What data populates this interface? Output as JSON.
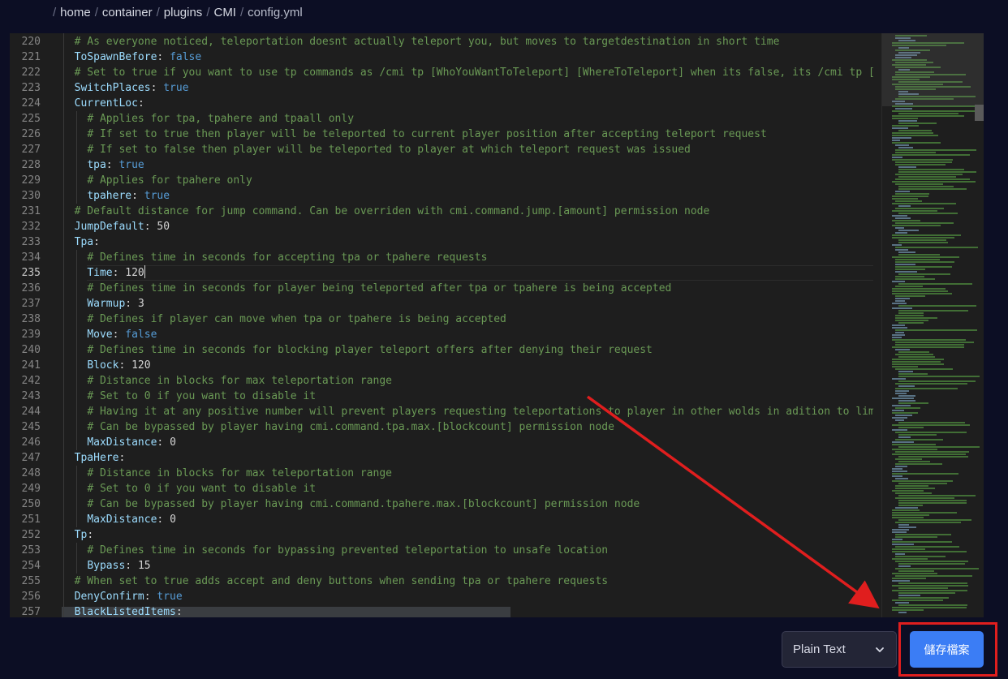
{
  "breadcrumb": {
    "separator": "/",
    "segments": [
      "home",
      "container",
      "plugins",
      "CMI",
      "config.yml"
    ]
  },
  "editor": {
    "active_line": 235,
    "lines": [
      {
        "num": "220",
        "indent": 1,
        "tokens": [
          {
            "t": "# As everyone noticed, teleportation doesnt actually teleport you, but moves to targetdestination in short time",
            "c": "comment"
          }
        ]
      },
      {
        "num": "221",
        "indent": 1,
        "tokens": [
          {
            "t": "ToSpawnBefore",
            "c": "key"
          },
          {
            "t": ": ",
            "c": "plain"
          },
          {
            "t": "false",
            "c": "bool"
          }
        ]
      },
      {
        "num": "222",
        "indent": 1,
        "tokens": [
          {
            "t": "# Set to true if you want to use tp commands as /cmi tp [WhoYouWantToTeleport] [WhereToTeleport] when its false, its /cmi tp [",
            "c": "comment"
          }
        ]
      },
      {
        "num": "223",
        "indent": 1,
        "tokens": [
          {
            "t": "SwitchPlaces",
            "c": "key"
          },
          {
            "t": ": ",
            "c": "plain"
          },
          {
            "t": "true",
            "c": "bool"
          }
        ]
      },
      {
        "num": "224",
        "indent": 1,
        "tokens": [
          {
            "t": "CurrentLoc",
            "c": "key"
          },
          {
            "t": ":",
            "c": "plain"
          }
        ]
      },
      {
        "num": "225",
        "indent": 2,
        "tokens": [
          {
            "t": "# Applies for tpa, tpahere and tpaall only",
            "c": "comment"
          }
        ]
      },
      {
        "num": "226",
        "indent": 2,
        "tokens": [
          {
            "t": "# If set to true then player will be teleported to current player position after accepting teleport request",
            "c": "comment"
          }
        ]
      },
      {
        "num": "227",
        "indent": 2,
        "tokens": [
          {
            "t": "# If set to false then player will be teleported to player at which teleport request was issued",
            "c": "comment"
          }
        ]
      },
      {
        "num": "228",
        "indent": 2,
        "tokens": [
          {
            "t": "tpa",
            "c": "key"
          },
          {
            "t": ": ",
            "c": "plain"
          },
          {
            "t": "true",
            "c": "bool"
          }
        ]
      },
      {
        "num": "229",
        "indent": 2,
        "tokens": [
          {
            "t": "# Applies for tpahere only",
            "c": "comment"
          }
        ]
      },
      {
        "num": "230",
        "indent": 2,
        "tokens": [
          {
            "t": "tpahere",
            "c": "key"
          },
          {
            "t": ": ",
            "c": "plain"
          },
          {
            "t": "true",
            "c": "bool"
          }
        ]
      },
      {
        "num": "231",
        "indent": 1,
        "tokens": [
          {
            "t": "# Default distance for jump command. Can be overriden with cmi.command.jump.[amount] permission node",
            "c": "comment"
          }
        ]
      },
      {
        "num": "232",
        "indent": 1,
        "tokens": [
          {
            "t": "JumpDefault",
            "c": "key"
          },
          {
            "t": ": ",
            "c": "plain"
          },
          {
            "t": "50",
            "c": "plain"
          }
        ]
      },
      {
        "num": "233",
        "indent": 1,
        "tokens": [
          {
            "t": "Tpa",
            "c": "key"
          },
          {
            "t": ":",
            "c": "plain"
          }
        ]
      },
      {
        "num": "234",
        "indent": 2,
        "tokens": [
          {
            "t": "# Defines time in seconds for accepting tpa or tpahere requests",
            "c": "comment"
          }
        ]
      },
      {
        "num": "235",
        "indent": 2,
        "tokens": [
          {
            "t": "Time",
            "c": "key"
          },
          {
            "t": ": ",
            "c": "plain"
          },
          {
            "t": "120",
            "c": "plain"
          }
        ],
        "cursor": true
      },
      {
        "num": "236",
        "indent": 2,
        "tokens": [
          {
            "t": "# Defines time in seconds for player being teleported after tpa or tpahere is being accepted",
            "c": "comment"
          }
        ]
      },
      {
        "num": "237",
        "indent": 2,
        "tokens": [
          {
            "t": "Warmup",
            "c": "key"
          },
          {
            "t": ": ",
            "c": "plain"
          },
          {
            "t": "3",
            "c": "plain"
          }
        ]
      },
      {
        "num": "238",
        "indent": 2,
        "tokens": [
          {
            "t": "# Defines if player can move when tpa or tpahere is being accepted",
            "c": "comment"
          }
        ]
      },
      {
        "num": "239",
        "indent": 2,
        "tokens": [
          {
            "t": "Move",
            "c": "key"
          },
          {
            "t": ": ",
            "c": "plain"
          },
          {
            "t": "false",
            "c": "bool"
          }
        ]
      },
      {
        "num": "240",
        "indent": 2,
        "tokens": [
          {
            "t": "# Defines time in seconds for blocking player teleport offers after denying their request",
            "c": "comment"
          }
        ]
      },
      {
        "num": "241",
        "indent": 2,
        "tokens": [
          {
            "t": "Block",
            "c": "key"
          },
          {
            "t": ": ",
            "c": "plain"
          },
          {
            "t": "120",
            "c": "plain"
          }
        ]
      },
      {
        "num": "242",
        "indent": 2,
        "tokens": [
          {
            "t": "# Distance in blocks for max teleportation range",
            "c": "comment"
          }
        ]
      },
      {
        "num": "243",
        "indent": 2,
        "tokens": [
          {
            "t": "# Set to 0 if you want to disable it",
            "c": "comment"
          }
        ]
      },
      {
        "num": "244",
        "indent": 2,
        "tokens": [
          {
            "t": "# Having it at any positive number will prevent players requesting teleportations to player in other wolds in adition to lim",
            "c": "comment"
          }
        ]
      },
      {
        "num": "245",
        "indent": 2,
        "tokens": [
          {
            "t": "# Can be bypassed by player having cmi.command.tpa.max.[blockcount] permission node",
            "c": "comment"
          }
        ]
      },
      {
        "num": "246",
        "indent": 2,
        "tokens": [
          {
            "t": "MaxDistance",
            "c": "key"
          },
          {
            "t": ": ",
            "c": "plain"
          },
          {
            "t": "0",
            "c": "plain"
          }
        ]
      },
      {
        "num": "247",
        "indent": 1,
        "tokens": [
          {
            "t": "TpaHere",
            "c": "key"
          },
          {
            "t": ":",
            "c": "plain"
          }
        ]
      },
      {
        "num": "248",
        "indent": 2,
        "tokens": [
          {
            "t": "# Distance in blocks for max teleportation range",
            "c": "comment"
          }
        ]
      },
      {
        "num": "249",
        "indent": 2,
        "tokens": [
          {
            "t": "# Set to 0 if you want to disable it",
            "c": "comment"
          }
        ]
      },
      {
        "num": "250",
        "indent": 2,
        "tokens": [
          {
            "t": "# Can be bypassed by player having cmi.command.tpahere.max.[blockcount] permission node",
            "c": "comment"
          }
        ]
      },
      {
        "num": "251",
        "indent": 2,
        "tokens": [
          {
            "t": "MaxDistance",
            "c": "key"
          },
          {
            "t": ": ",
            "c": "plain"
          },
          {
            "t": "0",
            "c": "plain"
          }
        ]
      },
      {
        "num": "252",
        "indent": 1,
        "tokens": [
          {
            "t": "Tp",
            "c": "key"
          },
          {
            "t": ":",
            "c": "plain"
          }
        ]
      },
      {
        "num": "253",
        "indent": 2,
        "tokens": [
          {
            "t": "# Defines time in seconds for bypassing prevented teleportation to unsafe location",
            "c": "comment"
          }
        ]
      },
      {
        "num": "254",
        "indent": 2,
        "tokens": [
          {
            "t": "Bypass",
            "c": "key"
          },
          {
            "t": ": ",
            "c": "plain"
          },
          {
            "t": "15",
            "c": "plain"
          }
        ]
      },
      {
        "num": "255",
        "indent": 1,
        "tokens": [
          {
            "t": "# When set to true adds accept and deny buttons when sending tpa or tpahere requests",
            "c": "comment"
          }
        ]
      },
      {
        "num": "256",
        "indent": 1,
        "tokens": [
          {
            "t": "DenyConfirm",
            "c": "key"
          },
          {
            "t": ": ",
            "c": "plain"
          },
          {
            "t": "true",
            "c": "bool"
          }
        ]
      },
      {
        "num": "257",
        "indent": 1,
        "tokens": [
          {
            "t": "BlackListedItems",
            "c": "key"
          },
          {
            "t": ":",
            "c": "plain"
          }
        ]
      }
    ]
  },
  "footer": {
    "language_select": {
      "selected": "Plain Text",
      "icon": "chevron-down-icon"
    },
    "save_button": {
      "label": "儲存檔案"
    }
  },
  "colors": {
    "page_bg": "#0c0e24",
    "editor_bg": "#1e1e1e",
    "comment": "#6a9955",
    "key": "#9cdcfe",
    "boolean": "#569cd6",
    "save_button": "#3b7df5",
    "annotation": "#e01e1e"
  }
}
